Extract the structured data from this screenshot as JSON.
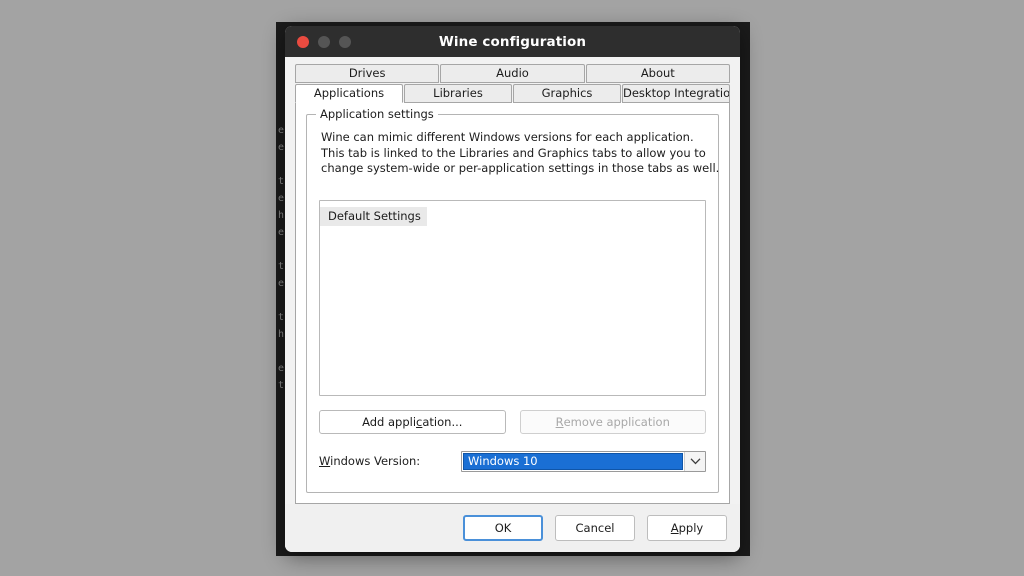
{
  "desktop": {
    "background_color": "#a3a3a3"
  },
  "background_window": {
    "name": "terminal-behind",
    "background_color": "#1b1b1b",
    "text": "e\ne\n\nt\ne\nh\ne\n\nt\ne\n\nt\nh\n\ne\nt"
  },
  "window": {
    "title": "Wine configuration",
    "titlebar_color": "#2e2e2e",
    "controls": {
      "close_label": "",
      "minimize_label": "",
      "maximize_label": "",
      "close_color": "#ea4b40",
      "minimize_color": "#555555",
      "maximize_color": "#555555"
    }
  },
  "tabs": {
    "row1": [
      {
        "label": "Drives",
        "active": false
      },
      {
        "label": "Audio",
        "active": false
      },
      {
        "label": "About",
        "active": false
      }
    ],
    "row2": [
      {
        "label": "Applications",
        "active": true
      },
      {
        "label": "Libraries",
        "active": false
      },
      {
        "label": "Graphics",
        "active": false
      },
      {
        "label": "Desktop Integration",
        "active": false
      }
    ]
  },
  "groupbox": {
    "title": "Application settings",
    "description_line1": "Wine can mimic different Windows versions for each application.",
    "description_line2": "This tab is linked to the Libraries and Graphics tabs to allow you to",
    "description_line3": "change system-wide or per-application settings in those tabs as well."
  },
  "application_list": {
    "items": [
      {
        "label": "Default Settings",
        "selected": true
      }
    ]
  },
  "app_buttons": {
    "add": {
      "pre": "Add appli",
      "mnemonic": "c",
      "post": "ation...",
      "disabled": false
    },
    "remove": {
      "pre": "",
      "mnemonic": "R",
      "post": "emove application",
      "disabled": true
    }
  },
  "windows_version": {
    "label_mnemonic": "W",
    "label_rest": "indows Version:",
    "value": "Windows 10",
    "highlight_color": "#1a6fd4",
    "dropdown_icon": "chevron-down-icon"
  },
  "dialog_buttons": {
    "ok": {
      "pre": "OK",
      "mnemonic": "",
      "post": "",
      "default": true
    },
    "cancel": {
      "pre": "Cancel",
      "mnemonic": "",
      "post": "",
      "default": false
    },
    "apply": {
      "pre": "",
      "mnemonic": "A",
      "post": "pply",
      "default": false
    }
  }
}
